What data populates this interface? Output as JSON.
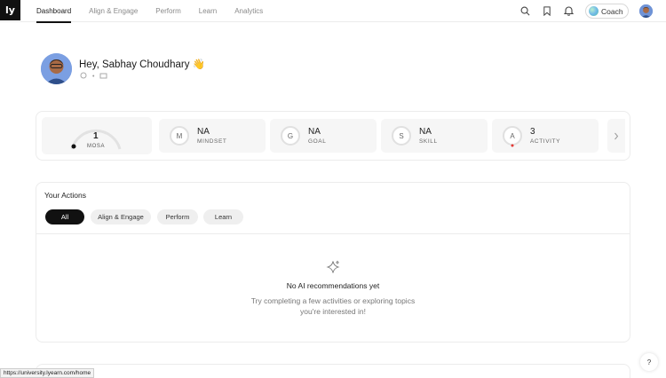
{
  "app": {
    "logo_text": "ly"
  },
  "nav": {
    "items": [
      {
        "label": "Dashboard",
        "active": true
      },
      {
        "label": "Align & Engage",
        "active": false
      },
      {
        "label": "Perform",
        "active": false
      },
      {
        "label": "Learn",
        "active": false
      },
      {
        "label": "Analytics",
        "active": false
      }
    ]
  },
  "header": {
    "icons": [
      "search-icon",
      "bookmark-icon",
      "bell-icon"
    ],
    "coach_label": "Coach"
  },
  "greeting": {
    "text": "Hey, Sabhay Choudhary",
    "emoji": "👋"
  },
  "stats": {
    "mosa": {
      "value": "1",
      "label": "MOSA"
    },
    "items": [
      {
        "letter": "M",
        "value": "NA",
        "label": "MINDSET"
      },
      {
        "letter": "G",
        "value": "NA",
        "label": "GOAL"
      },
      {
        "letter": "S",
        "value": "NA",
        "label": "SKILL"
      },
      {
        "letter": "A",
        "value": "3",
        "label": "ACTIVITY"
      }
    ],
    "next_icon": "chevron-right-icon"
  },
  "actions": {
    "title": "Your Actions",
    "filters": [
      {
        "label": "All",
        "active": true
      },
      {
        "label": "Align & Engage",
        "active": false
      },
      {
        "label": "Perform",
        "active": false
      },
      {
        "label": "Learn",
        "active": false
      }
    ],
    "empty_title": "No AI recommendations yet",
    "empty_text": "Try completing a few activities or exploring topics you're interested in!"
  },
  "status_bar": {
    "url": "https://university.lyearn.com/home"
  },
  "help": {
    "label": "?"
  },
  "colors": {
    "accent": "#111111",
    "activity_dot": "#e53935"
  }
}
